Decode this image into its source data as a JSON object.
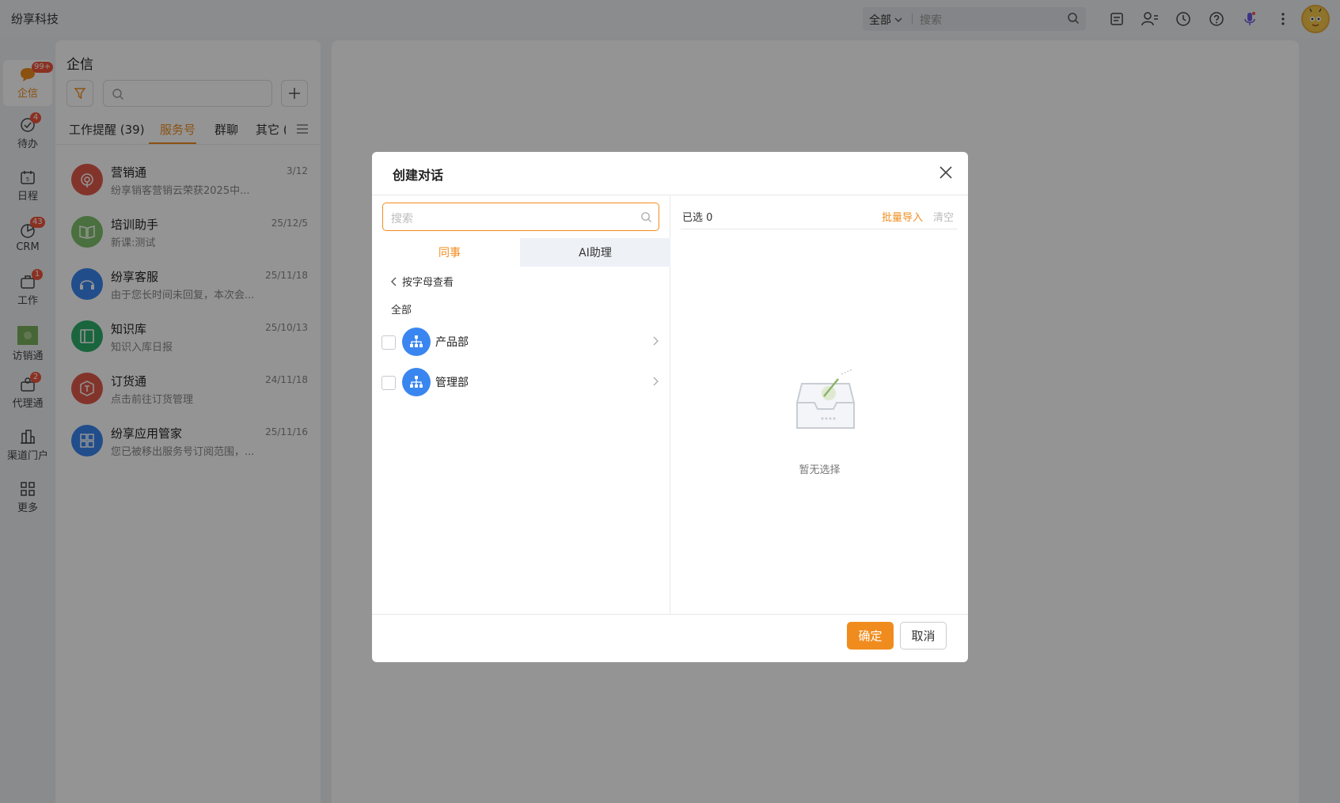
{
  "app": {
    "title": "纷享科技"
  },
  "search": {
    "scope": "全部",
    "placeholder": "搜索"
  },
  "rail": [
    {
      "label": "企信",
      "badge": "99+",
      "icon": "chat-bubble-icon"
    },
    {
      "label": "待办",
      "badge": "4",
      "icon": "check-circle-icon"
    },
    {
      "label": "日程",
      "badge": "",
      "icon": "calendar-icon"
    },
    {
      "label": "CRM",
      "badge": "43",
      "icon": "pie-chart-icon"
    },
    {
      "label": "工作",
      "badge": "1",
      "icon": "briefcase-icon"
    },
    {
      "label": "访销通",
      "badge": "",
      "icon": "visit-app-icon"
    },
    {
      "label": "代理通",
      "badge": "2",
      "icon": "agent-icon"
    },
    {
      "label": "渠道门户",
      "badge": "",
      "icon": "building-icon"
    },
    {
      "label": "更多",
      "badge": "",
      "icon": "grid-icon"
    }
  ],
  "convlist": {
    "title": "企信",
    "tabs": [
      "工作提醒 (39)",
      "服务号",
      "群聊",
      "其它 ("
    ],
    "active_tab": 1,
    "items": [
      {
        "name": "营销通",
        "date": "3/12",
        "preview": "纷享销客营销云荣获2025中...",
        "color": "#e05b4a",
        "icon": "broadcast-icon"
      },
      {
        "name": "培训助手",
        "date": "25/12/5",
        "preview": "新课:测试",
        "color": "#7ec26b",
        "icon": "book-icon"
      },
      {
        "name": "纷享客服",
        "date": "25/11/18",
        "preview": "由于您长时间未回复，本次会...",
        "color": "#3a86f0",
        "icon": "headset-icon"
      },
      {
        "name": "知识库",
        "date": "25/10/13",
        "preview": "知识入库日报",
        "color": "#2eae6a",
        "icon": "knowledge-icon"
      },
      {
        "name": "订货通",
        "date": "24/11/18",
        "preview": "点击前往订货管理",
        "color": "#e05b4a",
        "icon": "order-icon"
      },
      {
        "name": "纷享应用管家",
        "date": "25/11/16",
        "preview": "您已被移出服务号订阅范围，...",
        "color": "#3a86f0",
        "icon": "apps-icon"
      }
    ]
  },
  "modal": {
    "title": "创建对话",
    "search_placeholder": "搜索",
    "tabs": [
      "同事",
      "AI助理"
    ],
    "back_label": "按字母查看",
    "all_label": "全部",
    "departments": [
      "产品部",
      "管理部"
    ],
    "selected_label": "已选 0",
    "bulk_import": "批量导入",
    "clear": "清空",
    "empty_text": "暂无选择",
    "ok": "确定",
    "cancel": "取消"
  },
  "colors": {
    "accent": "#f08c1e",
    "badge": "#f0553c",
    "dept_blue": "#3a86f0"
  }
}
